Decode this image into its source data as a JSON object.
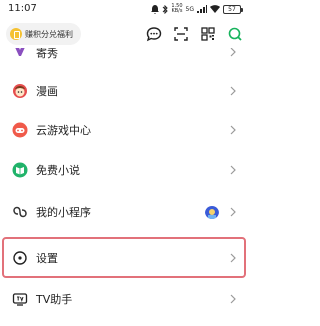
{
  "status_bar": {
    "time": "11:07",
    "network_speed": "1.50\nKB/s",
    "network_type": "5G",
    "battery_level": "57"
  },
  "action_row": {
    "points_label": "赚积分兑福利",
    "icons": [
      "message-icon",
      "scan-icon",
      "qr-code-icon",
      "search-icon"
    ]
  },
  "menu": {
    "items": [
      {
        "label": "寄秀",
        "icon": "jixiu-icon"
      },
      {
        "label": "漫画",
        "icon": "comic-icon"
      },
      {
        "label": "云游戏中心",
        "icon": "cloud-game-icon"
      },
      {
        "label": "免费小说",
        "icon": "novel-icon"
      },
      {
        "label": "我的小程序",
        "icon": "mini-program-icon"
      },
      {
        "label": "设置",
        "icon": "settings-icon"
      },
      {
        "label": "TV助手",
        "icon": "tv-icon"
      }
    ]
  },
  "colors": {
    "highlight": "#e2717a",
    "accent_green": "#16b35c",
    "coin": "#f5c232"
  }
}
